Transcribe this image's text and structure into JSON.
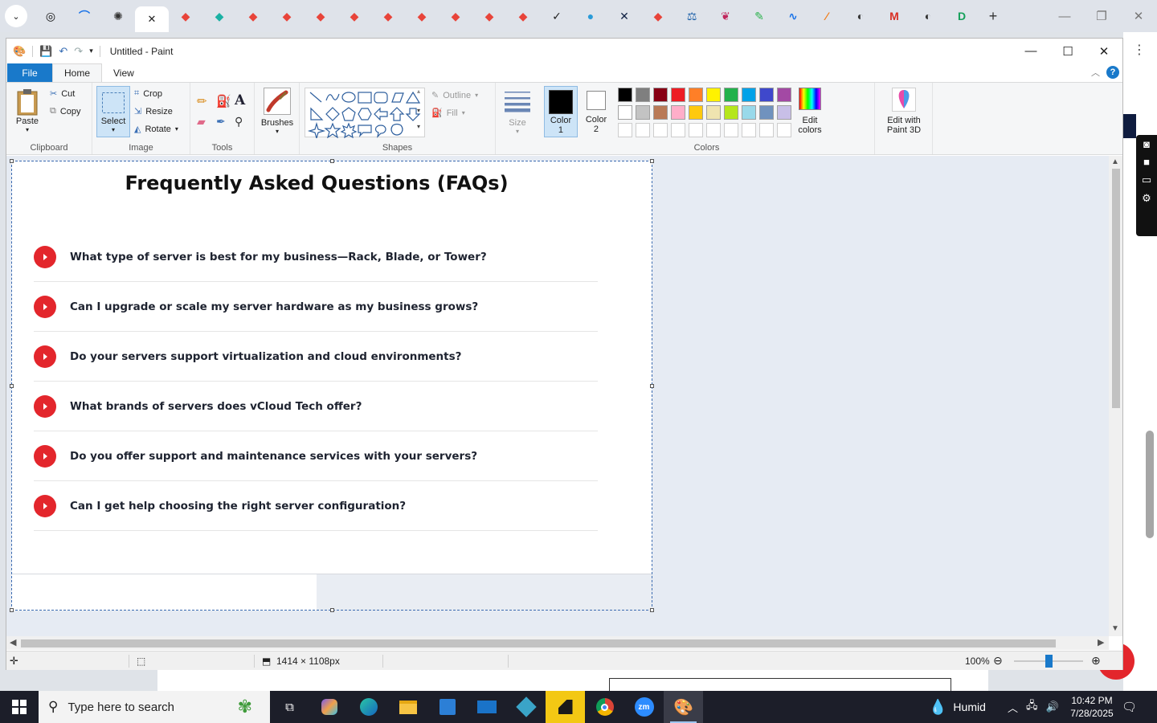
{
  "browser": {
    "active_tab_close": "✕",
    "new_tab": "+",
    "tabs": [
      {
        "icon": "chatgpt-icon",
        "color": "#111111",
        "glyph": "◎"
      },
      {
        "icon": "rainbow-icon",
        "color": "#1a73e8",
        "glyph": "⌒"
      },
      {
        "icon": "openai-icon",
        "color": "#333333",
        "glyph": "✺"
      },
      {
        "icon": "diamond-icon",
        "color": "#e8443a",
        "glyph": "◆"
      },
      {
        "icon": "diamond-icon",
        "color": "#1bb1a4",
        "glyph": "◆"
      },
      {
        "icon": "diamond-icon",
        "color": "#e8443a",
        "glyph": "◆"
      },
      {
        "icon": "diamond-icon",
        "color": "#e8443a",
        "glyph": "◆"
      },
      {
        "icon": "diamond-icon",
        "color": "#e8443a",
        "glyph": "◆"
      },
      {
        "icon": "diamond-icon",
        "color": "#e8443a",
        "glyph": "◆"
      },
      {
        "icon": "diamond-icon",
        "color": "#e8443a",
        "glyph": "◆"
      },
      {
        "icon": "diamond-icon",
        "color": "#e8443a",
        "glyph": "◆"
      },
      {
        "icon": "diamond-icon",
        "color": "#e8443a",
        "glyph": "◆"
      },
      {
        "icon": "diamond-icon",
        "color": "#e8443a",
        "glyph": "◆"
      },
      {
        "icon": "diamond-icon",
        "color": "#e8443a",
        "glyph": "◆"
      },
      {
        "icon": "check-icon",
        "color": "#222222",
        "glyph": "✓"
      },
      {
        "icon": "circle-icon",
        "color": "#2a9bd8",
        "glyph": "●"
      },
      {
        "icon": "x-icon",
        "color": "#112244",
        "glyph": "✕"
      },
      {
        "icon": "diamond-icon",
        "color": "#e8443a",
        "glyph": "◆"
      },
      {
        "icon": "scale-icon",
        "color": "#1a5fa8",
        "glyph": "⚖"
      },
      {
        "icon": "leaf-icon",
        "color": "#c0265c",
        "glyph": "❦"
      },
      {
        "icon": "pen-icon",
        "color": "#2bb24c",
        "glyph": "✎"
      },
      {
        "icon": "pulse-icon",
        "color": "#1a73e8",
        "glyph": "∿"
      },
      {
        "icon": "slash-icon",
        "color": "#f07c18",
        "glyph": "⁄"
      },
      {
        "icon": "globe-icon",
        "color": "#333333",
        "glyph": "◐"
      },
      {
        "icon": "gmail-icon",
        "color": "#d93025",
        "glyph": "M"
      },
      {
        "icon": "globe-icon",
        "color": "#333333",
        "glyph": "◐"
      },
      {
        "icon": "d-icon",
        "color": "#15a05a",
        "glyph": "D"
      }
    ]
  },
  "paint": {
    "title": "Untitled - Paint",
    "menu": {
      "file": "File",
      "home": "Home",
      "view": "View"
    },
    "clipboard": {
      "paste": "Paste",
      "cut": "Cut",
      "copy": "Copy",
      "label": "Clipboard"
    },
    "image": {
      "select": "Select",
      "crop": "Crop",
      "resize": "Resize",
      "rotate": "Rotate",
      "label": "Image"
    },
    "tools": {
      "label": "Tools"
    },
    "brushes": {
      "label": "Brushes"
    },
    "shapes": {
      "outline": "Outline",
      "fill": "Fill",
      "label": "Shapes"
    },
    "size": {
      "label": "Size"
    },
    "color1": {
      "label": "Color\n1",
      "value": "#000000"
    },
    "color2": {
      "label": "Color\n2",
      "value": "#ffffff"
    },
    "colors": {
      "label": "Colors",
      "row1": [
        "#000000",
        "#7f7f7f",
        "#880015",
        "#ed1c24",
        "#ff7f27",
        "#fff200",
        "#22b14c",
        "#00a2e8",
        "#3f48cc",
        "#a349a4"
      ],
      "row2": [
        "#ffffff",
        "#c3c3c3",
        "#b97a57",
        "#ffaec9",
        "#ffc90e",
        "#efe4b0",
        "#b5e61d",
        "#99d9ea",
        "#7092be",
        "#c8bfe7"
      ]
    },
    "edit_colors": "Edit\ncolors",
    "edit_paint3d": "Edit with\nPaint 3D",
    "status": {
      "dimensions": "1414 × 1108px",
      "zoom": "100%"
    }
  },
  "canvas": {
    "title": "Frequently Asked Questions (FAQs)",
    "accent": "#e3262c",
    "faqs": [
      "What type of server is best for my business—Rack, Blade, or Tower?",
      "Can I upgrade or scale my server hardware as my business grows?",
      "Do your servers support virtualization and cloud environments?",
      "What brands of servers does vCloud Tech offer?",
      "Do you offer support and maintenance services with your servers?",
      "Can I get help choosing the right server configuration?"
    ]
  },
  "taskbar": {
    "search_placeholder": "Type here to search",
    "weather": "Humid",
    "time": "10:42 PM",
    "date": "7/28/2025"
  }
}
